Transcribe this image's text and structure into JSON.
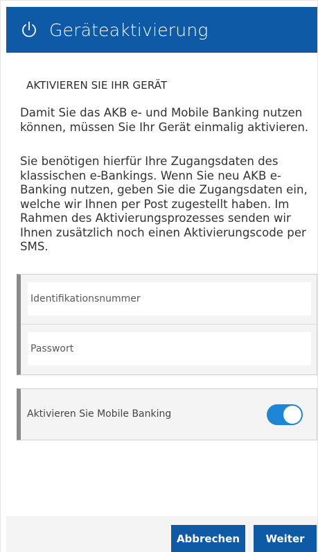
{
  "header": {
    "title": "Geräteaktivierung",
    "icon": "power-icon"
  },
  "main": {
    "section_title": "AKTIVIEREN SIE IHR GERÄT",
    "paragraph1": "Damit Sie das AKB e- und Mobile Banking nutzen können, müssen Sie Ihr Gerät einmalig aktivieren.",
    "paragraph2": "Sie benötigen hierfür Ihre Zugangsdaten des klassischen e-Bankings. Wenn Sie neu AKB e-Banking nutzen, geben Sie die Zugangsdaten ein, welche wir Ihnen per Post zugestellt haben. Im Rahmen des Aktivierungsprozesses senden wir Ihnen zusätzlich noch einen Aktivierungscode per SMS."
  },
  "form": {
    "id_placeholder": "Identifikationsnummer",
    "password_placeholder": "Passwort",
    "id_value": "",
    "password_value": ""
  },
  "toggle": {
    "label": "Aktivieren Sie Mobile Banking",
    "state": "on"
  },
  "footer": {
    "cancel_label": "Abbrechen",
    "next_label": "Weiter"
  },
  "colors": {
    "primary": "#0f5aa6",
    "toggle_on": "#1d86d6",
    "panel_bg": "#f4f4f4"
  }
}
